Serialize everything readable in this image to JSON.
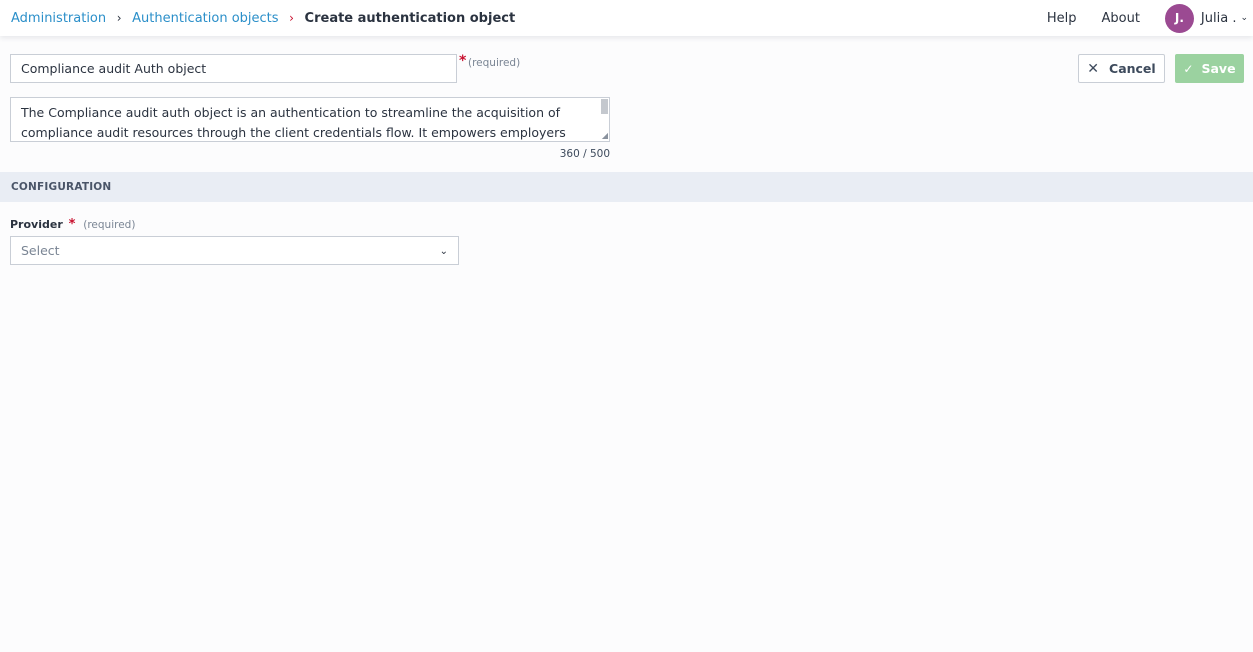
{
  "breadcrumb": {
    "items": [
      {
        "label": "Administration"
      },
      {
        "label": "Authentication objects"
      }
    ],
    "current": "Create authentication object"
  },
  "topnav": {
    "help": "Help",
    "about": "About",
    "user": {
      "initials": "J.",
      "name": "Julia ."
    }
  },
  "form": {
    "name_value": "Compliance audit Auth object",
    "required_marker": "*",
    "required_label": "(required)",
    "description_text": "The Compliance audit auth object is an authentication to streamline the acquisition of compliance audit resources through the client credentials flow. It empowers employers with seamless access",
    "char_count": "360 / 500"
  },
  "actions": {
    "cancel_label": "Cancel",
    "save_label": "Save",
    "cancel_icon": "x-icon",
    "save_icon": "check-icon"
  },
  "configuration": {
    "section_title": "CONFIGURATION",
    "provider_label": "Provider",
    "provider_required_marker": "*",
    "provider_required_label": "(required)",
    "provider_placeholder": "Select"
  },
  "colors": {
    "link": "#2b8fc9",
    "required": "#c8102e",
    "avatar": "#9b4a92",
    "save_disabled": "#9bd2a0",
    "section_bg": "#e9edf4"
  }
}
